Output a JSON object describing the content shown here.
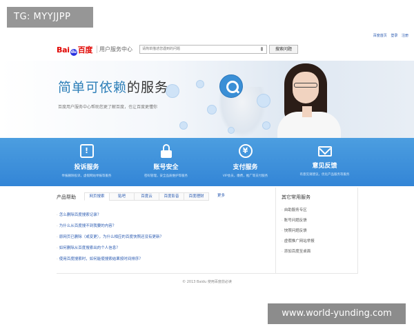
{
  "watermarks": {
    "top": "TG: MYYJJPP",
    "bottom": "www.world-yunding.com"
  },
  "top_links": [
    "百度首页",
    "登录",
    "注册"
  ],
  "header": {
    "logo_part1": "Bai",
    "logo_paw": "du",
    "logo_part2": "百度",
    "subtitle": "用户服务中心",
    "search_placeholder": "请简单描述您遇到的问题",
    "search_button": "搜索问题"
  },
  "hero": {
    "title_highlight": "简单可依赖",
    "title_rest": "的服务",
    "desc": "百度用户服务中心帮助您更了解百度，也让百度更懂你"
  },
  "services": [
    {
      "label": "投诉服务",
      "desc": "举报删除投诉，虚假网站举报等服务",
      "icon": "warning-icon"
    },
    {
      "label": "账号安全",
      "desc": "密码管理，安全品质维护等服务",
      "icon": "lock-icon"
    },
    {
      "label": "支付服务",
      "desc": "VIP会员，缴费，推广等支付服务",
      "icon": "yen-icon"
    },
    {
      "label": "意见反馈",
      "desc": "有意见请建议，优化产品服务等服务",
      "icon": "mail-icon"
    }
  ],
  "product_help": {
    "title": "产品帮助",
    "tabs": [
      "网页搜索",
      "贴吧",
      "百度云",
      "百度影音",
      "百度理财",
      "更多"
    ],
    "faqs": [
      "怎么删除百度搜索记录？",
      "为什么从百度搜不到我要的内容？",
      "原网页已删除（或变更），为什么相应的百度快照还没有更新？",
      "如何删除从百度搜索出的个人信息？",
      "使用百度搜索时，如何能使搜索结果按时间排序？"
    ]
  },
  "other_services": {
    "title": "其它常用服务",
    "items": [
      "自助服务专区",
      "账号问题反馈",
      "快照问题反馈",
      "虚假推广网站举报",
      "添加百度至桌面"
    ]
  },
  "footer": "© 2013 Baidu 使用百度前必读",
  "colors": {
    "brand_blue": "#3385d6",
    "link_blue": "#2b5bb1",
    "logo_red": "#e10602"
  }
}
